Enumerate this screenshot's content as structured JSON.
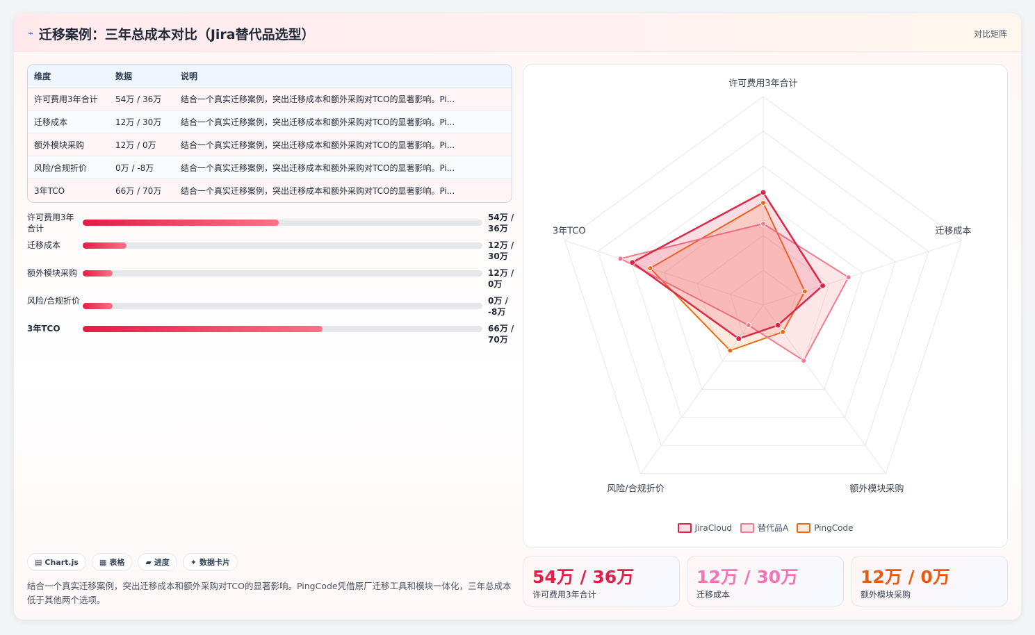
{
  "header": {
    "title": "迁移案例：三年总成本对比（Jira替代品选型）",
    "right_label": "对比矩阵"
  },
  "table": {
    "columns": [
      "维度",
      "数据",
      "说明"
    ],
    "rows": [
      {
        "dim": "许可费用3年合计",
        "data": "54万 / 36万",
        "note": "结合一个真实迁移案例，突出迁移成本和额外采购对TCO的显著影响。Pi..."
      },
      {
        "dim": "迁移成本",
        "data": "12万 / 30万",
        "note": "结合一个真实迁移案例，突出迁移成本和额外采购对TCO的显著影响。Pi..."
      },
      {
        "dim": "额外模块采购",
        "data": "12万 / 0万",
        "note": "结合一个真实迁移案例，突出迁移成本和额外采购对TCO的显著影响。Pi..."
      },
      {
        "dim": "风险/合规折价",
        "data": "0万 / -8万",
        "note": "结合一个真实迁移案例，突出迁移成本和额外采购对TCO的显著影响。Pi..."
      },
      {
        "dim": "3年TCO",
        "data": "66万 / 70万",
        "note": "结合一个真实迁移案例，突出迁移成本和额外采购对TCO的显著影响。Pi..."
      }
    ]
  },
  "progress": [
    {
      "label": "许可费用3年合计",
      "value": "54万 / 36万",
      "fraction": 0.49,
      "bold": false
    },
    {
      "label": "迁移成本",
      "value": "12万 / 30万",
      "fraction": 0.11,
      "bold": false
    },
    {
      "label": "额外模块采购",
      "value": "12万 / 0万",
      "fraction": 0.075,
      "bold": false
    },
    {
      "label": "风险/合规折价",
      "value": "0万 / -8万",
      "fraction": 0.075,
      "bold": false
    },
    {
      "label": "3年TCO",
      "value": "66万 / 70万",
      "fraction": 0.6,
      "bold": true
    }
  ],
  "chips": [
    {
      "icon": "▤",
      "label": "Chart.js"
    },
    {
      "icon": "▦",
      "label": "表格"
    },
    {
      "icon": "▰",
      "label": "进度"
    },
    {
      "icon": "✦",
      "label": "数据卡片"
    }
  ],
  "description": "结合一个真实迁移案例，突出迁移成本和额外采购对TCO的显著影响。PingCode凭借原厂迁移工具和模块一体化，三年总成本低于其他两个选项。",
  "kpis": [
    {
      "value": "54万 / 36万",
      "label": "许可费用3年合计",
      "color": "#e11d48"
    },
    {
      "value": "12万 / 30万",
      "label": "迁移成本",
      "color": "#f472b6"
    },
    {
      "value": "12万 / 0万",
      "label": "额外模块采购",
      "color": "#ea580c"
    }
  ],
  "colors": {
    "jira": "#dc2647",
    "alt": "#f07b8e",
    "ping": "#ea6a12"
  },
  "chart_data": {
    "type": "radar",
    "axes": [
      "许可费用3年合计",
      "迁移成本",
      "额外模块采购",
      "风险/合规折价",
      "3年TCO"
    ],
    "r_max": 100,
    "r_ticks": 6,
    "legend_position": "bottom",
    "series": [
      {
        "name": "JiraCloud",
        "values": [
          54,
          30,
          12,
          20,
          66
        ]
      },
      {
        "name": "替代品A",
        "values": [
          39,
          43,
          33,
          12,
          72
        ]
      },
      {
        "name": "PingCode",
        "values": [
          49,
          21,
          16,
          27,
          57
        ]
      }
    ]
  }
}
